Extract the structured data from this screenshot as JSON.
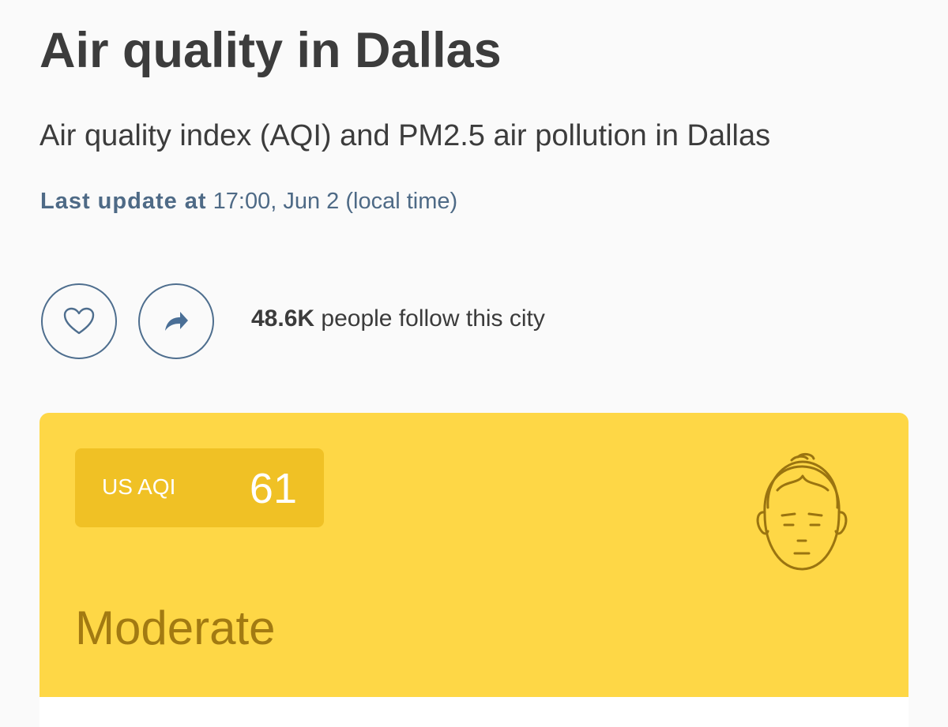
{
  "header": {
    "title": "Air quality in Dallas",
    "subtitle": "Air quality index (AQI) and PM2.5 air pollution in Dallas",
    "last_update_label": "Last update at",
    "last_update_value": "17:00, Jun 2 (local time)"
  },
  "actions": {
    "like_icon": "heart-outline-icon",
    "share_icon": "share-arrow-icon"
  },
  "followers": {
    "count": "48.6K",
    "text": "people follow this city"
  },
  "aqi": {
    "label": "US AQI",
    "value": "61",
    "status": "Moderate",
    "icon": "face-moderate-icon",
    "colors": {
      "card": "#fed746",
      "badge": "#f0c125",
      "status_text": "#a27a12",
      "icon_stroke": "#9a7410"
    }
  },
  "colors": {
    "accent": "#4e6e8e",
    "text": "#3c3c3c",
    "background": "#fafafa"
  }
}
